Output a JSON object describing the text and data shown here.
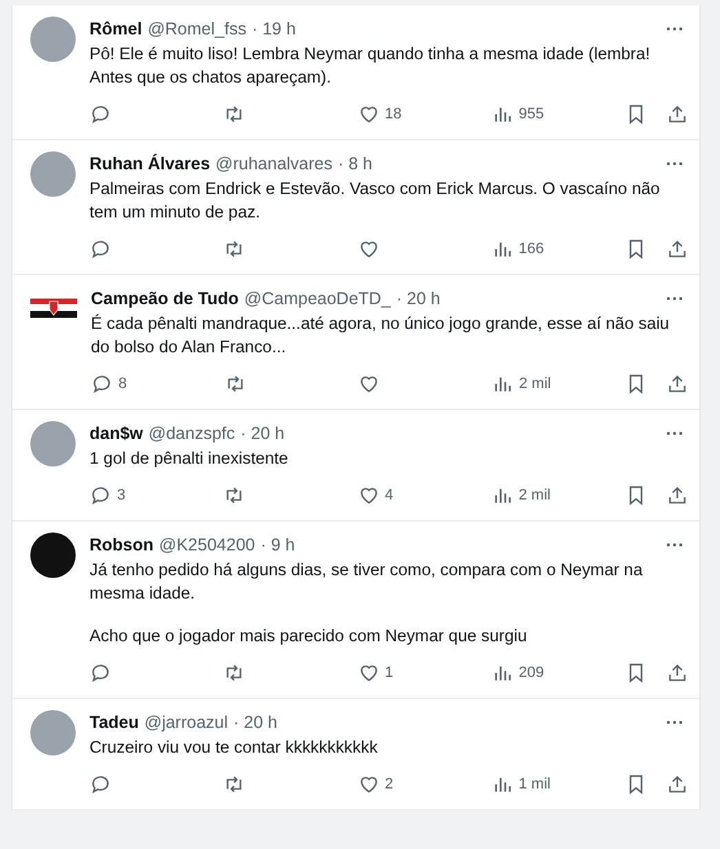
{
  "replies": [
    {
      "name": "Rômel",
      "handle": "@Romel_fss",
      "time": "· 19 h",
      "kind": "photo",
      "paragraphs": [
        "Pô! Ele é muito liso! Lembra Neymar quando tinha a mesma idade (lembra! Antes que os chatos apareçam)."
      ],
      "likes": "18",
      "views": "955"
    },
    {
      "name": "Ruhan Álvares",
      "handle": "@ruhanalvares",
      "time": "· 8 h",
      "kind": "photo",
      "paragraphs": [
        "Palmeiras com Endrick e Estevão. Vasco com Erick Marcus. O vascaíno não tem um minuto de paz."
      ],
      "views": "166"
    },
    {
      "name": "Campeão de Tudo",
      "handle": "@CampeaoDeTD_",
      "time": "· 20 h",
      "kind": "flag",
      "paragraphs": [
        "É cada pênalti mandraque...até agora, no único jogo grande, esse aí não saiu do bolso do Alan Franco..."
      ],
      "replies": "8",
      "views": "2 mil"
    },
    {
      "name": "dan$w",
      "handle": "@danzspfc",
      "time": "· 20 h",
      "kind": "photo",
      "paragraphs": [
        "1 gol de pênalti inexistente"
      ],
      "replies": "3",
      "likes": "4",
      "views": "2 mil"
    },
    {
      "name": "Robson",
      "handle": "@K2504200",
      "time": "· 9 h",
      "kind": "logo",
      "paragraphs": [
        "Já tenho pedido há alguns dias, se tiver como, compara com o Neymar na mesma idade.",
        "Acho que o jogador mais parecido com Neymar que surgiu"
      ],
      "likes": "1",
      "views": "209"
    },
    {
      "name": "Tadeu",
      "handle": "@jarroazul",
      "time": "· 20 h",
      "kind": "photo",
      "paragraphs": [
        "Cruzeiro viu vou te contar kkkkkkkkkkk"
      ],
      "likes": "2",
      "views": "1 mil"
    }
  ]
}
